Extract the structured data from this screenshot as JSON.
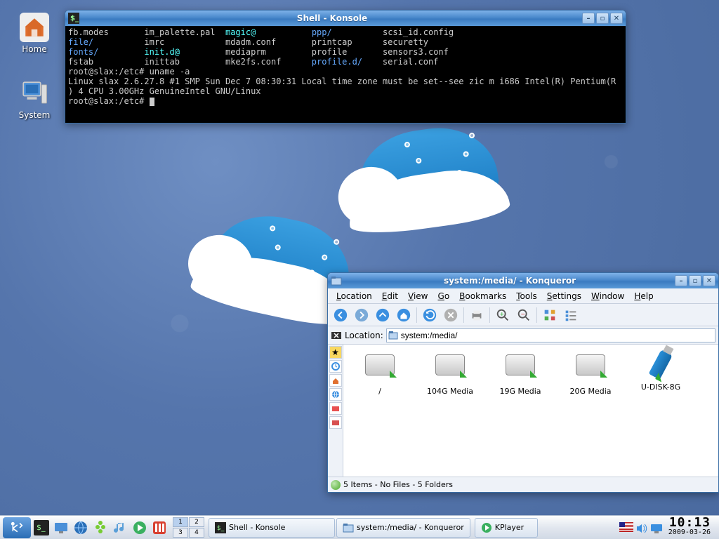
{
  "desktop": {
    "icons": [
      {
        "name": "home",
        "label": "Home"
      },
      {
        "name": "system",
        "label": "System"
      }
    ]
  },
  "konsole": {
    "title": "Shell - Konsole",
    "cols": [
      [
        "fb.modes",
        "file/",
        "fonts/",
        "fstab"
      ],
      [
        "im_palette.pal",
        "imrc",
        "init.d@",
        "inittab"
      ],
      [
        "magic@",
        "mdadm.conf",
        "mediaprm",
        "mke2fs.conf"
      ],
      [
        "ppp/",
        "printcap",
        "profile",
        "profile.d/"
      ],
      [
        "scsi_id.config",
        "securetty",
        "sensors3.conf",
        "serial.conf"
      ]
    ],
    "prompt1": "root@slax:/etc# ",
    "cmd1": "uname -a",
    "out1": "Linux slax 2.6.27.8 #1 SMP Sun Dec 7 08:30:31 Local time zone must be set--see zic m i686 Intel(R) Pentium(R",
    "out2": ") 4 CPU 3.00GHz GenuineIntel GNU/Linux",
    "prompt2": "root@slax:/etc# "
  },
  "konq": {
    "title": "system:/media/ - Konqueror",
    "menu": [
      "Location",
      "Edit",
      "View",
      "Go",
      "Bookmarks",
      "Tools",
      "Settings",
      "Window",
      "Help"
    ],
    "loc_label": "Location:",
    "loc_value": "system:/media/",
    "drives": [
      {
        "label": "/",
        "type": "hd"
      },
      {
        "label": "104G Media",
        "type": "hd"
      },
      {
        "label": "19G Media",
        "type": "hd"
      },
      {
        "label": "20G Media",
        "type": "hd"
      },
      {
        "label": "U-DISK-8G",
        "type": "usb"
      }
    ],
    "status": "5 Items - No Files - 5 Folders"
  },
  "taskbar": {
    "pager": [
      [
        "1",
        "2"
      ],
      [
        "3",
        "4"
      ]
    ],
    "pager_active": "1",
    "tasks": [
      {
        "label": "Shell - Konsole",
        "icon": "term"
      },
      {
        "label": "system:/media/ - Konqueror",
        "icon": "folder"
      }
    ],
    "taskbar_minis": [
      "KPlayer"
    ],
    "clock_time": "10:13",
    "clock_date": "2009-03-26"
  }
}
